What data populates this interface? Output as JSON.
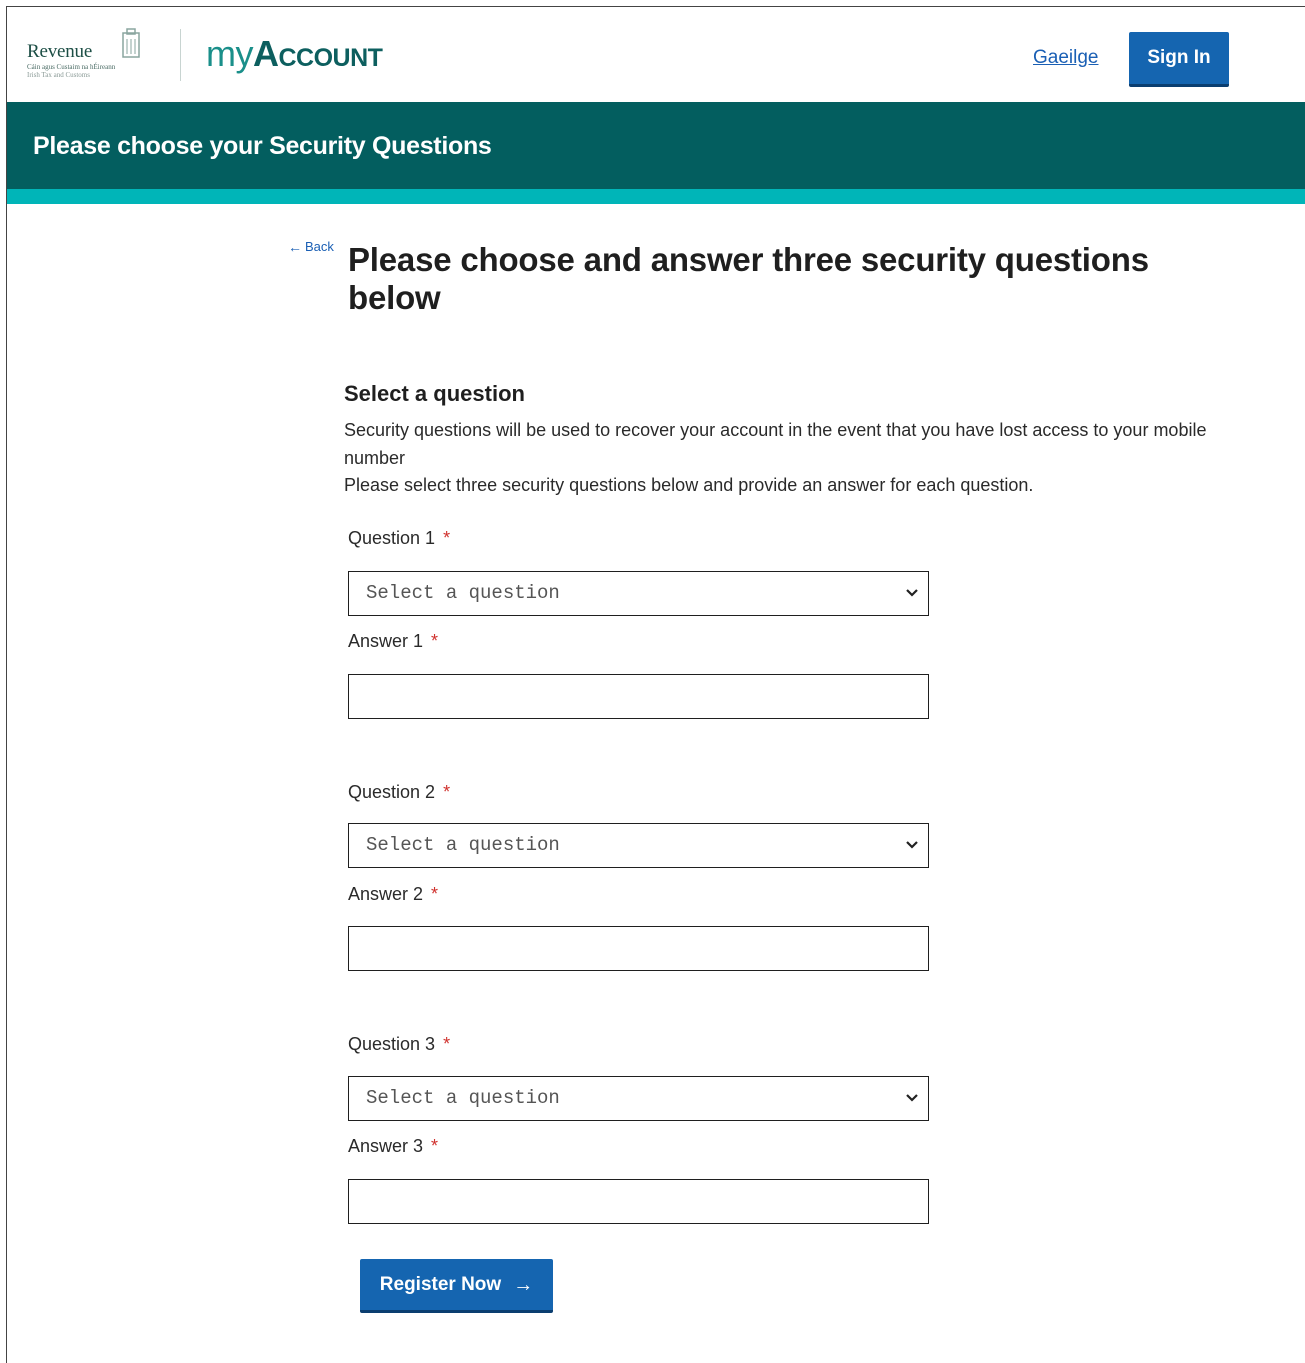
{
  "header": {
    "logo_word": "Revenue",
    "logo_sub1": "Cáin agus Custaim na hÉireann",
    "logo_sub2": "Irish Tax and Customs",
    "app_name_prefix": "my",
    "app_name_suffix": "Account",
    "language_link": "Gaeilge",
    "signin_label": "Sign In"
  },
  "banner": {
    "title": "Please choose your Security Questions"
  },
  "colors": {
    "banner_bg": "#035e5f",
    "accent_stripe": "#00b5b8",
    "primary_button": "#1565b0",
    "required": "#d0312d"
  },
  "main": {
    "back_label": "Back",
    "heading": "Please choose and answer three security questions below",
    "section_title": "Select a question",
    "intro_line1": "Security questions will be used to recover your account in the event that you have lost access to your mobile number",
    "intro_line2": "Please select three security questions below and provide an answer for each question.",
    "required_marker": "*",
    "questions": [
      {
        "label": "Question 1",
        "select_value": "Select a question",
        "answer_label": "Answer 1",
        "answer_value": ""
      },
      {
        "label": "Question 2",
        "select_value": "Select a question",
        "answer_label": "Answer 2",
        "answer_value": ""
      },
      {
        "label": "Question 3",
        "select_value": "Select a question",
        "answer_label": "Answer 3",
        "answer_value": ""
      }
    ],
    "submit_label": "Register Now"
  },
  "icons": {
    "back": "arrow-left-icon",
    "select": "chevron-down-icon",
    "submit": "arrow-right-icon",
    "logo": "harp-icon"
  }
}
